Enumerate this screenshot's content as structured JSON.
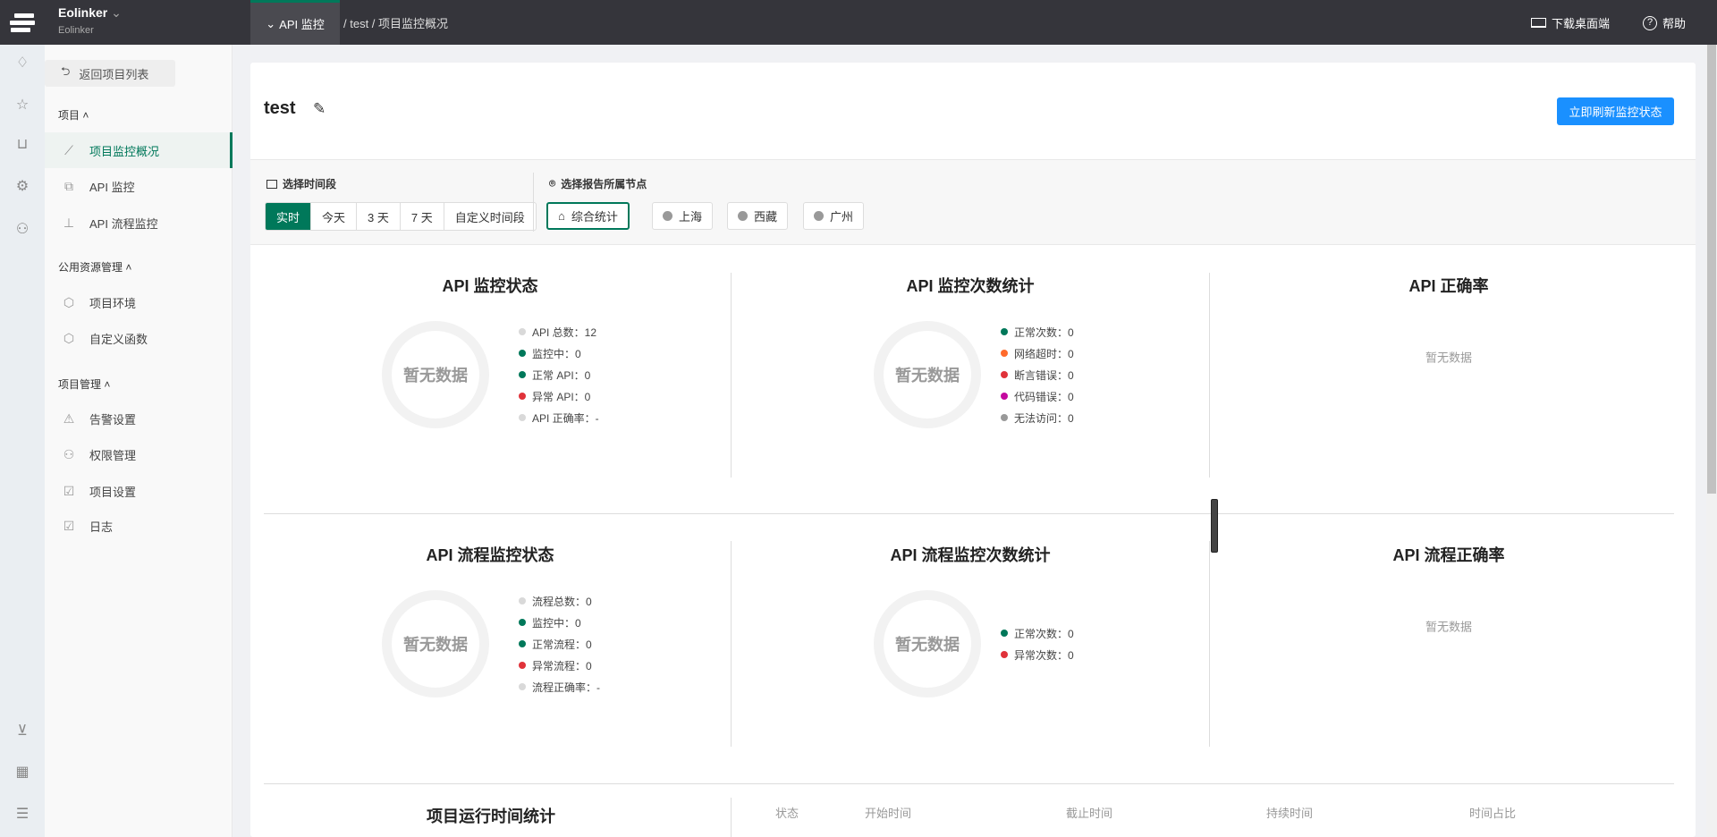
{
  "topbar": {
    "workspace": "Eolinker",
    "workspace_sub": "Eolinker",
    "module": "API 监控",
    "breadcrumb": "/ test / 项目监控概况",
    "download": "下载桌面端",
    "help": "帮助"
  },
  "sidebar": {
    "back": "返回项目列表",
    "sections": [
      {
        "title": "项目",
        "items": [
          {
            "label": "项目监控概况",
            "icon": "chart-line-icon",
            "active": true
          },
          {
            "label": "API 监控",
            "icon": "api-tag-icon"
          },
          {
            "label": "API 流程监控",
            "icon": "flow-tree-icon"
          }
        ]
      },
      {
        "title": "公用资源管理",
        "items": [
          {
            "label": "项目环境",
            "icon": "cube-icon"
          },
          {
            "label": "自定义函数",
            "icon": "cube-icon"
          }
        ]
      },
      {
        "title": "项目管理",
        "items": [
          {
            "label": "告警设置",
            "icon": "warning-icon"
          },
          {
            "label": "权限管理",
            "icon": "user-icon"
          },
          {
            "label": "项目设置",
            "icon": "clipboard-check-icon"
          },
          {
            "label": "日志",
            "icon": "clipboard-check-icon"
          }
        ]
      }
    ]
  },
  "main": {
    "title": "test",
    "refresh": "立即刷新监控状态",
    "time_label": "选择时间段",
    "time_options": [
      "实时",
      "今天",
      "3 天",
      "7 天",
      "自定义时间段"
    ],
    "time_selected": "实时",
    "node_label": "选择报告所属节点",
    "nodes": [
      "综合统计",
      "上海",
      "西藏",
      "广州"
    ],
    "node_selected": "综合统计",
    "no_data": "暂无数据",
    "panels": {
      "api_status": {
        "title": "API 监控状态",
        "legend": [
          {
            "label": "API 总数：12",
            "color": "#d9d9d9"
          },
          {
            "label": "监控中：0",
            "color": "#00785a"
          },
          {
            "label": "正常 API：0",
            "color": "#00785a"
          },
          {
            "label": "异常 API：0",
            "color": "#e0323a"
          },
          {
            "label": "API 正确率：-",
            "color": "#d9d9d9"
          }
        ]
      },
      "api_count": {
        "title": "API 监控次数统计",
        "legend": [
          {
            "label": "正常次数：0",
            "color": "#00785a"
          },
          {
            "label": "网络超时：0",
            "color": "#ff6a2b"
          },
          {
            "label": "断言错误：0",
            "color": "#e0323a"
          },
          {
            "label": "代码错误：0",
            "color": "#c4099f"
          },
          {
            "label": "无法访问：0",
            "color": "#999999"
          }
        ]
      },
      "api_rate": {
        "title": "API 正确率"
      },
      "flow_status": {
        "title": "API 流程监控状态",
        "legend": [
          {
            "label": "流程总数：0",
            "color": "#d9d9d9"
          },
          {
            "label": "监控中：0",
            "color": "#00785a"
          },
          {
            "label": "正常流程：0",
            "color": "#00785a"
          },
          {
            "label": "异常流程：0",
            "color": "#e0323a"
          },
          {
            "label": "流程正确率：-",
            "color": "#d9d9d9"
          }
        ]
      },
      "flow_count": {
        "title": "API 流程监控次数统计",
        "legend": [
          {
            "label": "正常次数：0",
            "color": "#00785a"
          },
          {
            "label": "异常次数：0",
            "color": "#e0323a"
          }
        ]
      },
      "flow_rate": {
        "title": "API 流程正确率"
      },
      "runtime": {
        "title": "项目运行时间统计",
        "columns": [
          "状态",
          "开始时间",
          "截止时间",
          "持续时间",
          "时间占比"
        ]
      }
    }
  }
}
